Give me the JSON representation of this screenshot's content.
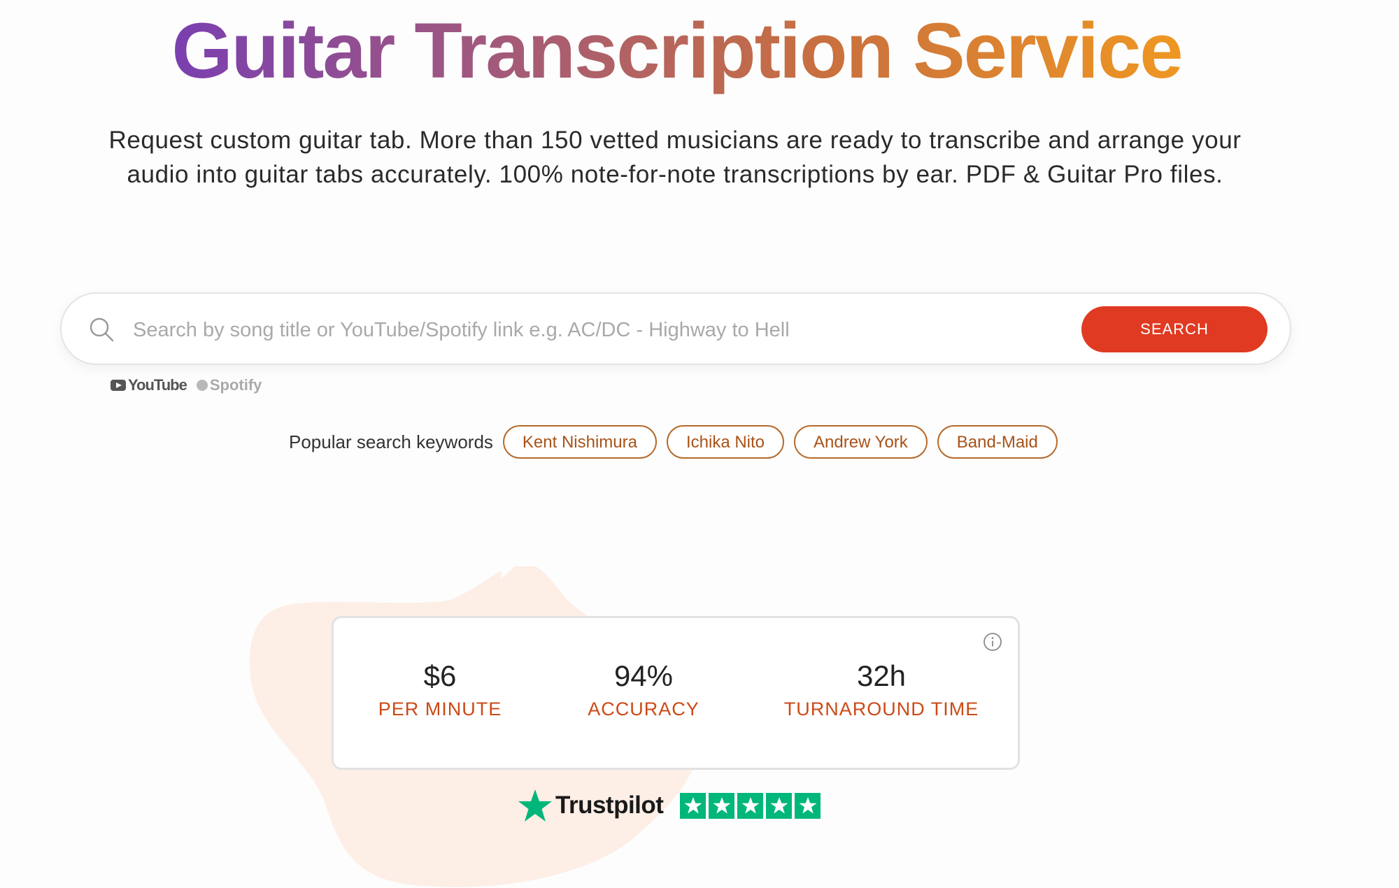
{
  "hero": {
    "title": "Guitar Transcription Service",
    "subtitle": "Request custom guitar tab. More than 150 vetted musicians are ready to transcribe and arrange your audio into guitar tabs accurately. 100% note-for-note transcriptions by ear. PDF & Guitar Pro files."
  },
  "search": {
    "placeholder": "Search by song title or YouTube/Spotify link e.g. AC/DC - Highway to Hell",
    "value": "",
    "button_label": "SEARCH",
    "sources": {
      "youtube": "YouTube",
      "spotify": "Spotify"
    }
  },
  "popular": {
    "label": "Popular search keywords",
    "keywords": [
      "Kent Nishimura",
      "Ichika Nito",
      "Andrew York",
      "Band-Maid"
    ]
  },
  "stats": [
    {
      "value": "$6",
      "label": "PER MINUTE"
    },
    {
      "value": "94%",
      "label": "ACCURACY"
    },
    {
      "value": "32h",
      "label": "TURNAROUND TIME"
    }
  ],
  "trustpilot": {
    "name": "Trustpilot",
    "rating": 5,
    "max_rating": 5
  },
  "colors": {
    "title_gradient_start": "#7a3fb0",
    "title_gradient_end": "#ef9722",
    "search_button": "#e03a22",
    "chip_border": "#b46a2c",
    "stat_label": "#cc4a16",
    "trustpilot_green": "#00b67a",
    "blob": "#fdeee6"
  },
  "icons": {
    "search": "search-icon",
    "info": "info-icon",
    "youtube": "youtube-logo-icon",
    "spotify": "spotify-logo-icon",
    "trustpilot_star": "star-icon"
  }
}
